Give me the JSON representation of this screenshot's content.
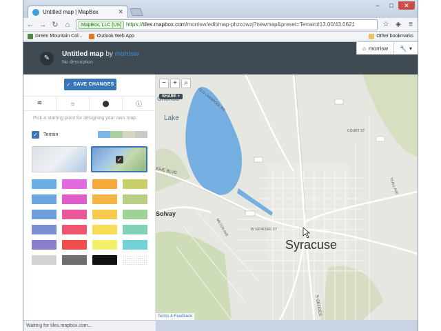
{
  "browser": {
    "tab_title": "Untitled map | MapBox",
    "window_controls": [
      "–",
      "□",
      "✕"
    ],
    "secure_badge": "MapBox, LLC [US]",
    "url_prefix": "https://",
    "url_host": "tiles.mapbox.com",
    "url_path": "/morrisw/edit/map-phzcowzj?newmap&preset=Terrain#13.00/43.0621",
    "bookmarks": [
      "Green Mountain Col...",
      "Outlook Web App"
    ],
    "other_bookmarks": "Other bookmarks",
    "status": "Waiting for tiles.mapbox.com..."
  },
  "header": {
    "map_title": "Untitled map",
    "by": "by",
    "user": "morrisw",
    "description": "No description",
    "user_button": "morrisw",
    "tools_button": "▾"
  },
  "sidebar": {
    "save_label": "SAVE CHANGES",
    "hint": "Pick a starting point for designing your own map.",
    "terrain_label": "Terrain",
    "terrain_swatches": [
      "#7fb6e6",
      "#aad09b",
      "#d7d4c2",
      "#c9c9c9"
    ],
    "palette": [
      "#6aaee3",
      "#e06be0",
      "#f5a93a",
      "#c9cf6a",
      "#6aa6dc",
      "#e05cc8",
      "#f5b545",
      "#b9d084",
      "#6f9fd8",
      "#e8589b",
      "#f7c94c",
      "#9ed196",
      "#7a8fd2",
      "#ee5571",
      "#f7dc55",
      "#7fd0b7",
      "#8a7fcc",
      "#f04d4d",
      "#f4ef6a",
      "#72d2d8",
      "#d4d4d4",
      "#6f6f6f",
      "#111111",
      "dots"
    ]
  },
  "map": {
    "zoom_in": "+",
    "zoom_out": "−",
    "search": "⌕",
    "share": "SHARE +",
    "footer": "Terms & Feedback",
    "labels": {
      "lake": "Onondaga Lake",
      "solvay": "Solvay",
      "syracuse": "Syracuse",
      "erie": "ERIE BLVD",
      "geddes": "S GEDDES",
      "genesee": "W GENESEE ST",
      "court": "COURT ST",
      "teall": "TEALL AVE",
      "old_liv": "OLD LIVERPOOL RD",
      "milton": "MILTON AVE",
      "ronondo": "ONONDAGA"
    }
  }
}
